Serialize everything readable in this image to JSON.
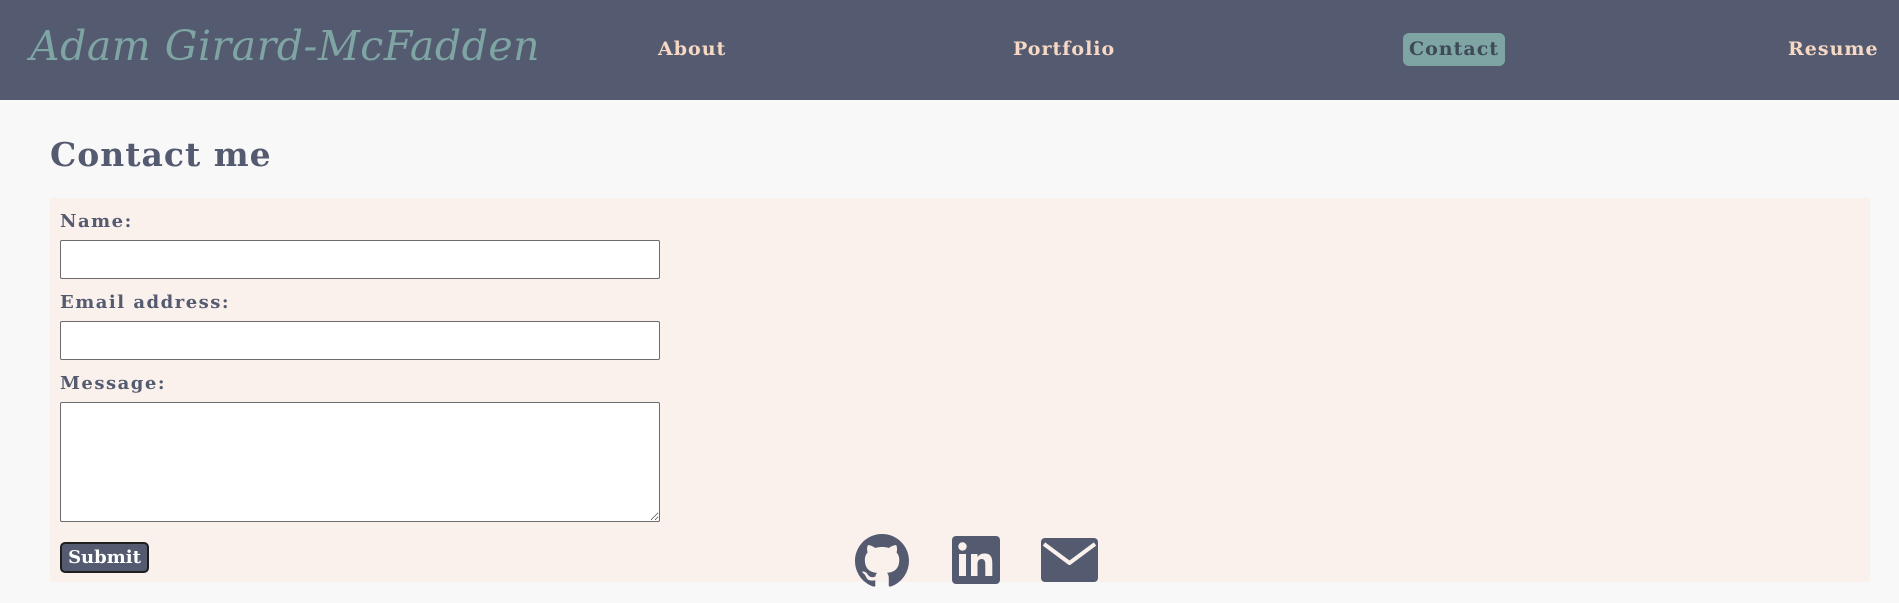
{
  "header": {
    "title": "Adam Girard-McFadden",
    "nav": {
      "about": "About",
      "portfolio": "Portfolio",
      "contact": "Contact",
      "resume": "Resume"
    },
    "active_nav": "contact"
  },
  "main": {
    "heading": "Contact me",
    "form": {
      "name_label": "Name:",
      "name_value": "",
      "email_label": "Email address:",
      "email_value": "",
      "message_label": "Message:",
      "message_value": "",
      "submit_label": "Submit"
    }
  },
  "social": {
    "icons": [
      "github-icon",
      "linkedin-icon",
      "envelope-icon"
    ]
  },
  "colors": {
    "header_bg": "#545b70",
    "title": "#7ea5a4",
    "nav_text": "#f7d8c4",
    "active_nav_bg": "#7ea5a4",
    "panel_bg": "#fbf1ec",
    "page_bg": "#f9f8f9",
    "accent": "#545b70"
  }
}
